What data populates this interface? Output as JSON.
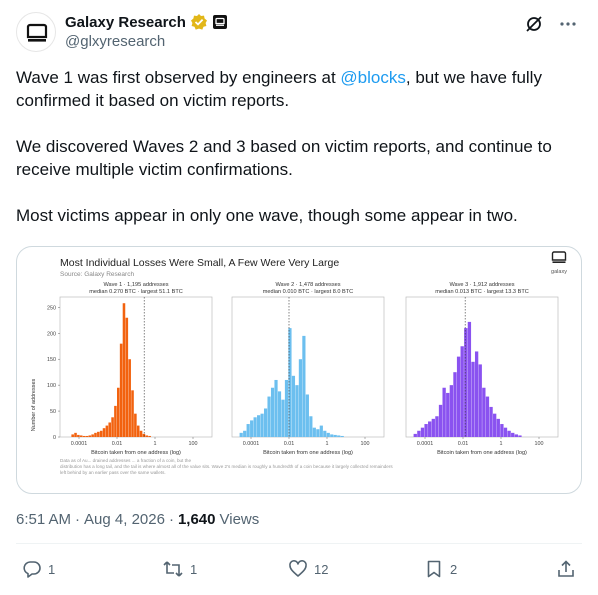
{
  "author": {
    "display_name": "Galaxy Research",
    "handle": "@glxyresearch",
    "avatar_icon": "galaxy-logo-icon",
    "verified_badge_color": "#e2b719"
  },
  "post": {
    "paragraph1_before": "Wave 1 was first observed by engineers at ",
    "mention": "@blocks",
    "paragraph1_after": ", but we have fully confirmed it based on victim reports.",
    "paragraph2": "We discovered Waves 2 and 3 based on victim reports, and continue to receive multiple victim confirmations.",
    "paragraph3": "Most victims appear in only one wave, though some appear in two."
  },
  "card": {
    "title": "Most Individual Losses Were Small, A Few Were Very Large",
    "source": "Source: Galaxy Research",
    "logo_label": "galaxy",
    "ylabel": "Number of addresses",
    "footnote_line1": "Data as of Au... drained addresses ... a fraction of a coin, but the",
    "footnote_line2": "distribution has a long tail, and the tail is where almost all of the value sits. Wave 2's median is roughly a hundredth of a coin because it largely collected remainders",
    "footnote_line3": "left behind by an earlier pass over the same wallets."
  },
  "chart_data": [
    {
      "type": "bar",
      "title": "Wave 1 · 1,195 addresses",
      "subtitle": "median 0.270 BTC · largest 51.1 BTC",
      "xlabel": "Bitcoin taken from one address (log)",
      "ylabel": "Number of addresses",
      "xscale": "log",
      "xlim": [
        1e-05,
        1000
      ],
      "x_ticks": [
        "0.0001",
        "0.01",
        "1",
        "100"
      ],
      "ylim": [
        0,
        270
      ],
      "y_ticks": [
        0,
        50,
        100,
        150,
        200,
        250
      ],
      "color": "#f2620f",
      "median": 0.27,
      "bin_log10_edges": [
        -4.4,
        -0.2
      ],
      "values": [
        5,
        8,
        4,
        3,
        2,
        2,
        3,
        5,
        8,
        10,
        12,
        17,
        22,
        28,
        38,
        60,
        95,
        180,
        258,
        230,
        150,
        90,
        45,
        22,
        12,
        6,
        3,
        2
      ]
    },
    {
      "type": "bar",
      "title": "Wave 2 · 1,478 addresses",
      "subtitle": "median 0.010 BTC · largest 8.0 BTC",
      "xlabel": "Bitcoin taken from one address (log)",
      "xscale": "log",
      "xlim": [
        1e-05,
        1000
      ],
      "x_ticks": [
        "0.0001",
        "0.01",
        "1",
        "100"
      ],
      "ylim": [
        0,
        270
      ],
      "color": "#6cbfef",
      "median": 0.01,
      "bin_log10_edges": [
        -4.6,
        0.9
      ],
      "values": [
        8,
        12,
        25,
        32,
        38,
        42,
        45,
        55,
        78,
        95,
        110,
        88,
        72,
        110,
        210,
        118,
        100,
        150,
        195,
        82,
        40,
        18,
        15,
        22,
        12,
        8,
        5,
        4,
        3,
        2
      ]
    },
    {
      "type": "bar",
      "title": "Wave 3 · 1,912 addresses",
      "subtitle": "median 0.013 BTC · largest 13.3 BTC",
      "xlabel": "Bitcoin taken from one address (log)",
      "xscale": "log",
      "xlim": [
        1e-05,
        1000
      ],
      "x_ticks": [
        "0.0001",
        "0.01",
        "1",
        "100"
      ],
      "ylim": [
        0,
        270
      ],
      "color": "#8a52f0",
      "median": 0.013,
      "bin_log10_edges": [
        -4.6,
        1.1
      ],
      "values": [
        6,
        12,
        18,
        25,
        30,
        35,
        40,
        62,
        95,
        85,
        100,
        125,
        155,
        175,
        210,
        222,
        145,
        165,
        140,
        95,
        78,
        58,
        45,
        35,
        25,
        18,
        12,
        8,
        5,
        3
      ]
    }
  ],
  "meta": {
    "time": "6:51 AM",
    "date": "Aug 4, 2026",
    "views_count": "1,640",
    "views_label": "Views"
  },
  "actions": {
    "replies": "1",
    "reposts": "1",
    "likes": "12",
    "bookmarks": "2"
  }
}
